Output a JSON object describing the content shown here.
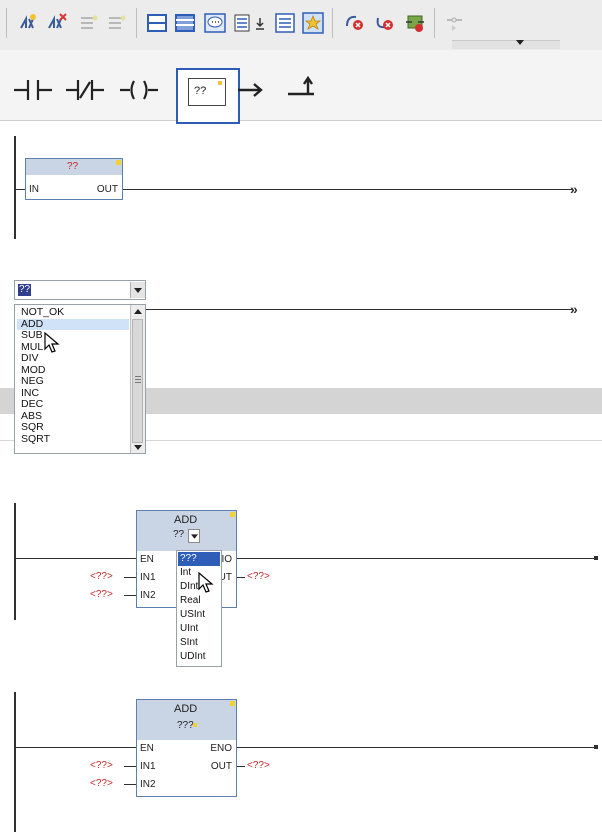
{
  "ladder_elements": {
    "box_label": "??"
  },
  "empty_box": {
    "type_text": "??",
    "in_label": "IN",
    "out_label": "OUT"
  },
  "instruction_dropdown": {
    "input_value": "??",
    "items": [
      "NOT_OK",
      "ADD",
      "SUB",
      "MUL",
      "DIV",
      "MOD",
      "NEG",
      "INC",
      "DEC",
      "ABS",
      "SQR",
      "SQRT"
    ],
    "hovered_item": "ADD"
  },
  "add_block_type_select": {
    "title": "ADD",
    "type_value": "??",
    "en_label": "EN",
    "eno_partial_label": "IO",
    "in1_label": "IN1",
    "in2_label": "IN2",
    "out_partial_label": "UT",
    "in1_operand": "<??>",
    "in2_operand": "<??>",
    "out_operand": "<??>",
    "type_options": [
      "???",
      "Int",
      "DInt",
      "Real",
      "USInt",
      "UInt",
      "SInt",
      "UDInt"
    ],
    "selected_option": "???"
  },
  "add_block_final": {
    "title": "ADD",
    "type_value": "???",
    "en_label": "EN",
    "eno_label": "ENO",
    "in1_label": "IN1",
    "in2_label": "IN2",
    "out_label": "OUT",
    "in1_operand": "<??>",
    "in2_operand": "<??>",
    "out_operand": "<??>"
  }
}
